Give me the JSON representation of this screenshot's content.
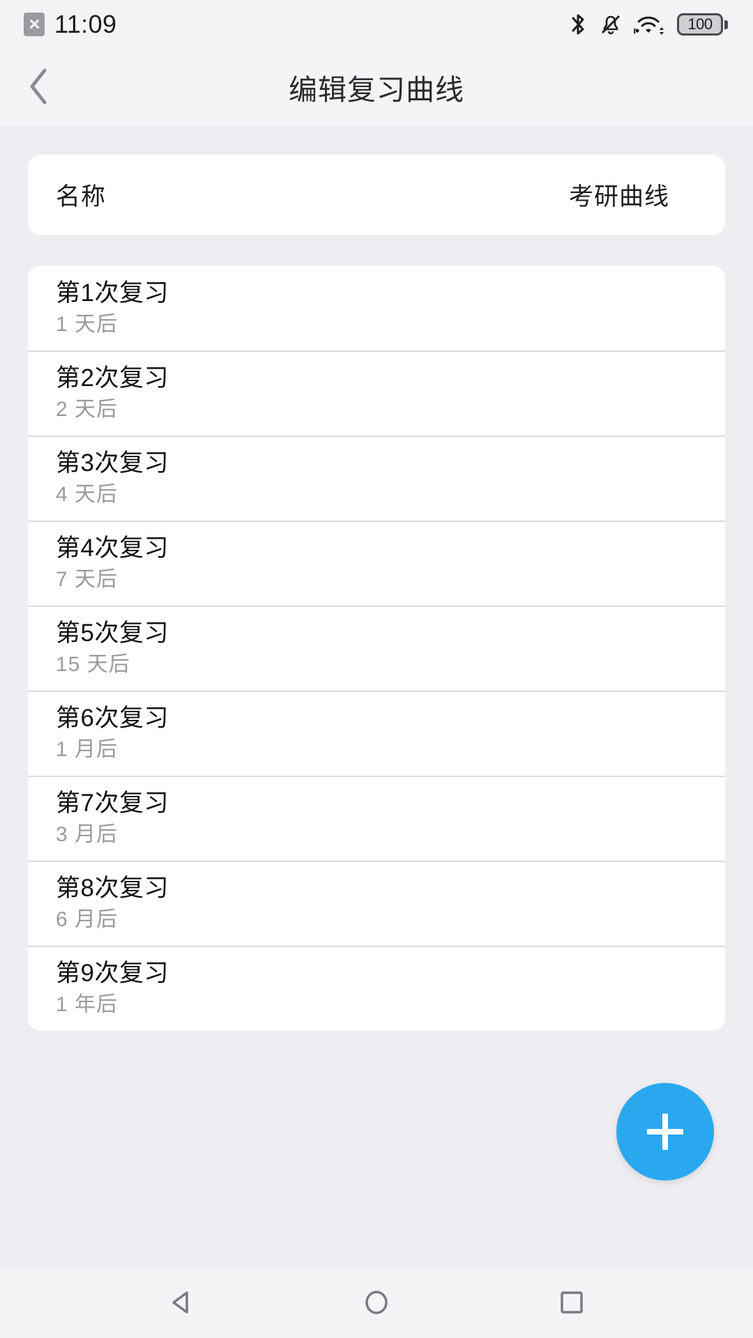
{
  "status_bar": {
    "time": "11:09",
    "left_icons": [
      "sms-failed-icon"
    ],
    "right_icons": [
      "bluetooth-icon",
      "ringer-muted-icon",
      "wifi-icon"
    ],
    "battery_level": "100"
  },
  "header": {
    "back_icon": "chevron-left-icon",
    "title": "编辑复习曲线"
  },
  "name_card": {
    "label": "名称",
    "value": "考研曲线"
  },
  "review_list": [
    {
      "title": "第1次复习",
      "subtitle": "1 天后"
    },
    {
      "title": "第2次复习",
      "subtitle": "2 天后"
    },
    {
      "title": "第3次复习",
      "subtitle": "4 天后"
    },
    {
      "title": "第4次复习",
      "subtitle": "7 天后"
    },
    {
      "title": "第5次复习",
      "subtitle": "15 天后"
    },
    {
      "title": "第6次复习",
      "subtitle": "1 月后"
    },
    {
      "title": "第7次复习",
      "subtitle": "3 月后"
    },
    {
      "title": "第8次复习",
      "subtitle": "6 月后"
    },
    {
      "title": "第9次复习",
      "subtitle": "1 年后"
    }
  ],
  "fab": {
    "icon": "plus-icon",
    "color": "#29a8f0"
  },
  "nav_bar": {
    "back_icon": "triangle-back-icon",
    "home_icon": "circle-home-icon",
    "recents_icon": "square-recents-icon"
  },
  "colors": {
    "page_background": "#eeeef2",
    "bar_background": "#f4f4f6",
    "card_background": "#ffffff",
    "primary_text": "#121214",
    "secondary_text": "#9a9a9e",
    "divider": "#d9d9de",
    "accent": "#29a8f0"
  }
}
